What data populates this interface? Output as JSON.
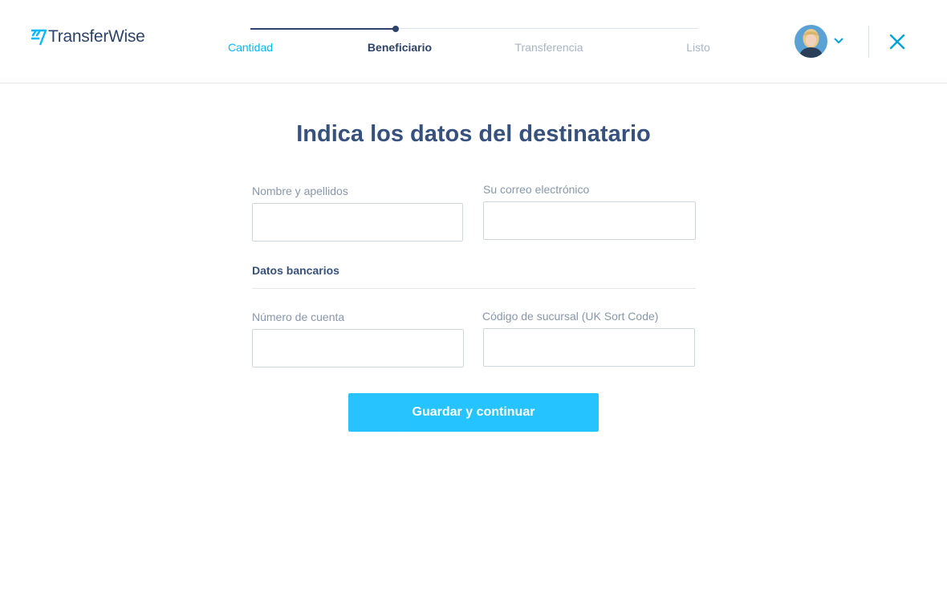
{
  "header": {
    "logo_text": "TransferWise",
    "steps": [
      {
        "label": "Cantidad",
        "state": "done"
      },
      {
        "label": "Beneficiario",
        "state": "active"
      },
      {
        "label": "Transferencia",
        "state": "todo"
      },
      {
        "label": "Listo",
        "state": "todo"
      }
    ]
  },
  "main": {
    "title": "Indica los datos del destinatario",
    "fields": {
      "full_name": {
        "label": "Nombre y apellidos",
        "value": ""
      },
      "email": {
        "label": "Su correo electrónico",
        "value": ""
      },
      "account_number": {
        "label": "Número de cuenta",
        "value": ""
      },
      "sort_code": {
        "label": "Código de sucursal (UK Sort Code)",
        "value": ""
      }
    },
    "bank_section_title": "Datos bancarios",
    "submit_label": "Guardar y continuar"
  },
  "colors": {
    "brand_navy": "#2e4369",
    "accent_blue": "#00b9ff",
    "muted_text": "#8797aa"
  },
  "icons": {
    "logo": "transferwise-flag-icon",
    "avatar": "user-avatar",
    "menu": "chevron-down-icon",
    "close": "close-icon"
  }
}
